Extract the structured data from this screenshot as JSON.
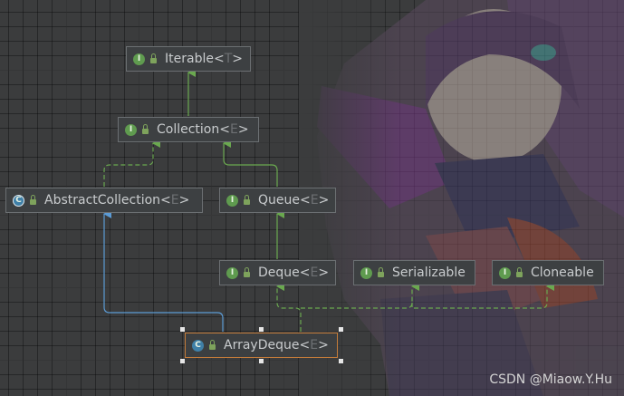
{
  "nodes": {
    "iterable": {
      "kind": "interface",
      "badge": "I",
      "name": "Iterable",
      "lt": "<",
      "param": "T",
      "gt": ">"
    },
    "collection": {
      "kind": "interface",
      "badge": "I",
      "name": "Collection",
      "lt": "<",
      "param": "E",
      "gt": ">"
    },
    "abstract_collection": {
      "kind": "abstract class",
      "badge": "C",
      "name": "AbstractCollection",
      "lt": "<",
      "param": "E",
      "gt": ">"
    },
    "queue": {
      "kind": "interface",
      "badge": "I",
      "name": "Queue",
      "lt": "<",
      "param": "E",
      "gt": ">"
    },
    "deque": {
      "kind": "interface",
      "badge": "I",
      "name": "Deque",
      "lt": "<",
      "param": "E",
      "gt": ">"
    },
    "serializable": {
      "kind": "interface",
      "badge": "I",
      "name": "Serializable"
    },
    "cloneable": {
      "kind": "interface",
      "badge": "I",
      "name": "Cloneable"
    },
    "array_deque": {
      "kind": "class",
      "badge": "C",
      "name": "ArrayDeque",
      "lt": "<",
      "param": "E",
      "gt": ">",
      "selected": true
    }
  },
  "edges": [
    {
      "from": "Collection",
      "to": "Iterable",
      "type": "extends"
    },
    {
      "from": "AbstractCollection",
      "to": "Collection",
      "type": "implements"
    },
    {
      "from": "Queue",
      "to": "Collection",
      "type": "extends"
    },
    {
      "from": "Deque",
      "to": "Queue",
      "type": "extends"
    },
    {
      "from": "ArrayDeque",
      "to": "AbstractCollection",
      "type": "extends"
    },
    {
      "from": "ArrayDeque",
      "to": "Deque",
      "type": "implements"
    },
    {
      "from": "ArrayDeque",
      "to": "Serializable",
      "type": "implements"
    },
    {
      "from": "ArrayDeque",
      "to": "Cloneable",
      "type": "implements"
    }
  ],
  "colors": {
    "canvas": "#3b3c3d",
    "interface_badge": "#5f9b4f",
    "class_badge": "#3f80a8",
    "extends_interface_line": "#6aa84f",
    "extends_class_line": "#5b9bd5",
    "implements_line": "#6aa84f",
    "selection_border": "#c47c3a"
  },
  "watermark": "CSDN @Miaow.Y.Hu"
}
